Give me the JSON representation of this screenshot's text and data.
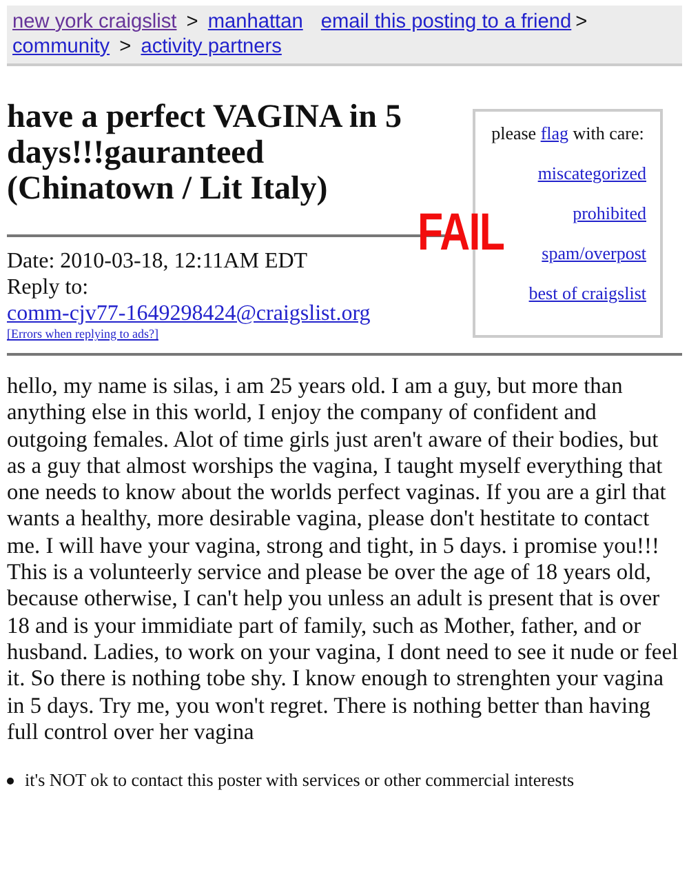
{
  "breadcrumbs": [
    {
      "label": "new york craigslist",
      "visited": true
    },
    {
      "label": "manhattan",
      "visited": false
    },
    {
      "label": "community",
      "visited": false
    },
    {
      "label": "activity partners",
      "visited": false
    }
  ],
  "separator": ">",
  "email_link": "email this posting to a friend",
  "title": "have a perfect VAGINA in 5 days!!!gauranteed (Chinatown / Lit Italy)",
  "stamp": "FAIL",
  "flag_box": {
    "lead": "please",
    "flag": "flag",
    "tail": "with care:",
    "links": [
      "miscategorized",
      "prohibited",
      "spam/overpost",
      "best of craigslist"
    ]
  },
  "date": "Date: 2010-03-18, 12:11AM EDT",
  "reply_label": "Reply to:",
  "reply_email": "comm-cjv77-1649298424@craigslist.org",
  "errors_link": "[Errors when replying to ads?]",
  "body": "hello, my name is silas, i am 25 years old. I am a guy, but more than anything else in this world, I enjoy the company of confident and outgoing females. Alot of time girls just aren't aware of their bodies, but as a guy that almost worships the vagina, I taught myself everything that one needs to know about the worlds perfect vaginas. If you are a girl that wants a healthy, more desirable vagina, please don't hestitate to contact me. I will have your vagina, strong and tight, in 5 days. i promise you!!! This is a volunteerly service and please be over the age of 18 years old, because otherwise, I can't help you unless an adult is present that is over 18 and is your immidiate part of family, such as Mother, father, and or husband. Ladies, to work on your vagina, I dont need to see it nude or feel it. So there is nothing tobe shy. I know enough to strenghten your vagina in 5 days. Try me, you won't regret. There is nothing better than having full control over her vagina",
  "notice": "it's NOT ok to contact this poster with services or other commercial interests"
}
